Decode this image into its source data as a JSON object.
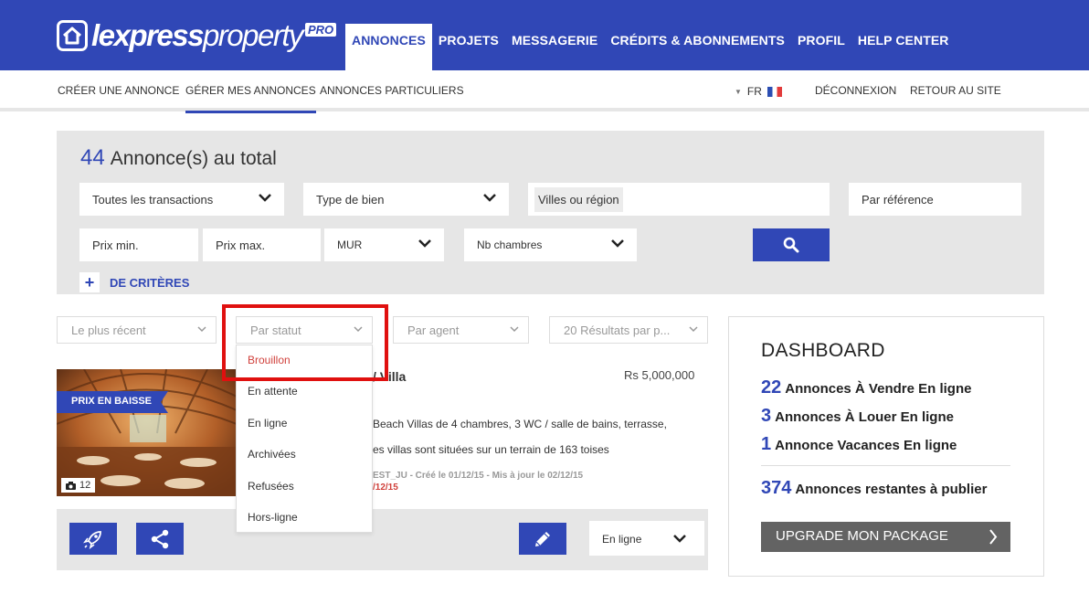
{
  "logo": {
    "brand_bold": "lexpress",
    "brand_light": "property",
    "tag": "PRO"
  },
  "main_nav": [
    {
      "label": "ANNONCES",
      "active": true
    },
    {
      "label": "PROJETS"
    },
    {
      "label": "MESSAGERIE"
    },
    {
      "label": "CRÉDITS & ABONNEMENTS"
    },
    {
      "label": "PROFIL"
    },
    {
      "label": "HELP CENTER"
    }
  ],
  "sub_nav": {
    "create": "CRÉER UNE ANNONCE",
    "manage": "GÉRER MES ANNONCES",
    "private": "ANNONCES PARTICULIERS",
    "language": "FR",
    "logout": "DÉCONNEXION",
    "back": "RETOUR AU SITE"
  },
  "search": {
    "total_count": "44",
    "total_label": "Annonce(s) au total",
    "transactions": "Toutes les transactions",
    "property_type": "Type de bien",
    "city_placeholder": "Villes ou région",
    "reference_placeholder": "Par référence",
    "price_min": "Prix min.",
    "price_max": "Prix max.",
    "currency": "MUR",
    "bedrooms": "Nb chambres",
    "more_criteria": "DE CRITÈRES"
  },
  "filters": {
    "sort": "Le plus récent",
    "status": "Par statut",
    "agent": "Par agent",
    "per_page": "20 Résultats par p..."
  },
  "status_options": [
    "Brouillon",
    "En attente",
    "En ligne",
    "Archivées",
    "Refusées",
    "Hors-ligne"
  ],
  "listing": {
    "badge": "PRIX EN BAISSE",
    "photo_count": "12",
    "title_fragment": "/ Villa",
    "price": "Rs 5,000,000",
    "desc_line1": "Beach Villas de 4 chambres, 3 WC / salle de bains, terrasse,",
    "desc_line2": "es villas sont situées sur un terrain de 163 toises",
    "meta": "EST_JU - Créé le 01/12/15 - Mis à jour le 02/12/15",
    "meta_date": "/12/15",
    "status": "En ligne"
  },
  "dashboard": {
    "title": "DASHBOARD",
    "sale_count": "22",
    "sale_label": "Annonces À Vendre En ligne",
    "rent_count": "3",
    "rent_label": "Annonces À Louer En ligne",
    "holiday_count": "1",
    "holiday_label": "Annonce Vacances En ligne",
    "remaining_count": "374",
    "remaining_label": "Annonces restantes à publier",
    "upgrade": "UPGRADE MON PACKAGE"
  },
  "colors": {
    "brand_blue": "#3047b6",
    "highlight_red": "#e0100f",
    "selected_red": "#d0403b"
  }
}
